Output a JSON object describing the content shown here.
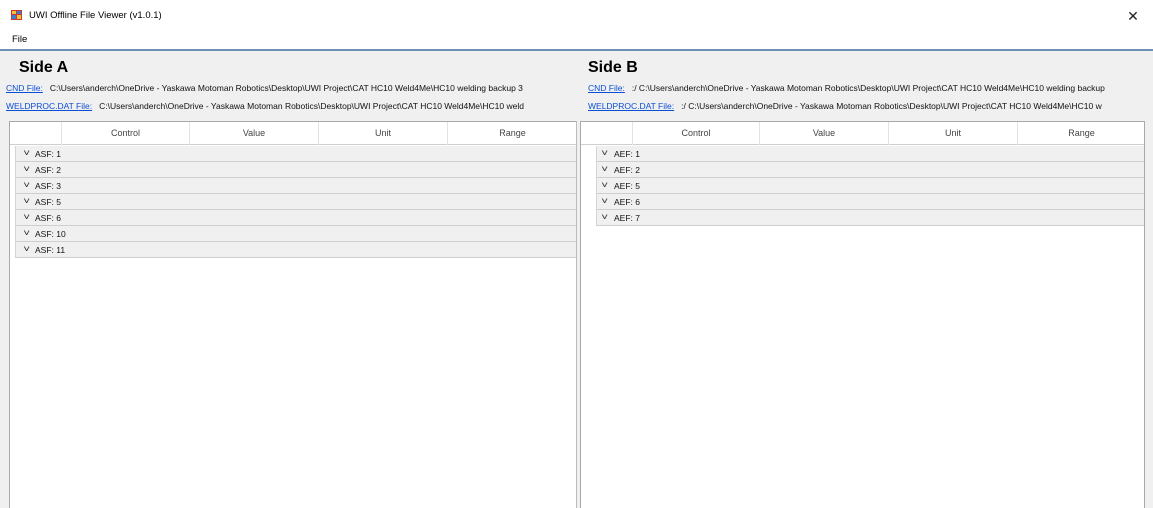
{
  "window": {
    "title": "UWI Offline File Viewer (v1.0.1)",
    "close_glyph": "✕",
    "icon": "app-window-icon"
  },
  "menubar": {
    "items": [
      {
        "label": "File"
      }
    ]
  },
  "side_a": {
    "title": "Side A",
    "cnd_link": "CND File:",
    "cnd_path": "C:\\Users\\anderch\\OneDrive - Yaskawa Motoman Robotics\\Desktop\\UWI Project\\CAT HC10 Weld4Me\\HC10 welding backup 3",
    "weld_link": "WELDPROC.DAT File:",
    "weld_path": "C:\\Users\\anderch\\OneDrive - Yaskawa Motoman Robotics\\Desktop\\UWI Project\\CAT HC10 Weld4Me\\HC10 weld",
    "columns": [
      "Control",
      "Value",
      "Unit",
      "Range"
    ],
    "rows": [
      {
        "label": "ASF: 1"
      },
      {
        "label": "ASF: 2"
      },
      {
        "label": "ASF: 3"
      },
      {
        "label": "ASF: 5"
      },
      {
        "label": "ASF: 6"
      },
      {
        "label": "ASF: 10"
      },
      {
        "label": "ASF: 11"
      }
    ]
  },
  "side_b": {
    "title": "Side B",
    "cnd_link": "CND File:",
    "cnd_path": ":/ C:\\Users\\anderch\\OneDrive - Yaskawa Motoman Robotics\\Desktop\\UWI Project\\CAT HC10 Weld4Me\\HC10 welding backup",
    "weld_link": "WELDPROC.DAT File:",
    "weld_path": ":/ C:\\Users\\anderch\\OneDrive - Yaskawa Motoman Robotics\\Desktop\\UWI Project\\CAT HC10 Weld4Me\\HC10 w",
    "columns": [
      "Control",
      "Value",
      "Unit",
      "Range"
    ],
    "rows": [
      {
        "label": "AEF: 1"
      },
      {
        "label": "AEF: 2"
      },
      {
        "label": "AEF: 5"
      },
      {
        "label": "AEF: 6"
      },
      {
        "label": "AEF: 7"
      }
    ]
  },
  "icons": {
    "row_expand": "chevron-down-icon",
    "chevron_glyph": "˅"
  },
  "colors": {
    "link": "#0b4fd6",
    "row_bg": "#f0f0f0",
    "menu_separator": "#6d8fb6"
  }
}
